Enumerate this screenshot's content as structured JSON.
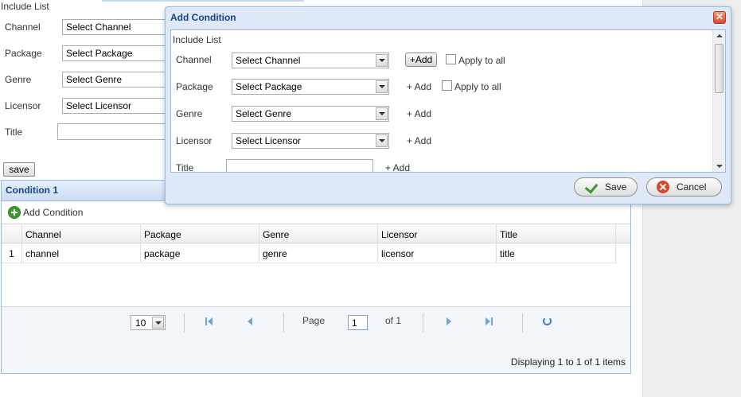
{
  "background_form": {
    "title": "Include List",
    "fields": [
      {
        "label": "Channel",
        "value": "Select Channel"
      },
      {
        "label": "Package",
        "value": "Select Package"
      },
      {
        "label": "Genre",
        "value": "Select Genre"
      },
      {
        "label": "Licensor",
        "value": "Select Licensor"
      }
    ],
    "title_label": "Title",
    "save_label": "save"
  },
  "condition_panel": {
    "header": "Condition 1",
    "add_condition_label": "Add Condition",
    "columns": [
      "Channel",
      "Package",
      "Genre",
      "Licensor",
      "Title"
    ],
    "rows": [
      {
        "num": "1",
        "cells": [
          "channel",
          "package",
          "genre",
          "licensor",
          "title"
        ]
      }
    ],
    "pager": {
      "page_size": "10",
      "page_label": "Page",
      "current_page": "1",
      "of_label": "of 1",
      "display_text": "Displaying 1 to 1 of 1 items"
    }
  },
  "modal": {
    "title": "Add Condition",
    "close_glyph": "✕",
    "include_list_label": "Include List",
    "rows": [
      {
        "label": "Channel",
        "value": "Select Channel"
      },
      {
        "label": "Package",
        "value": "Select Package"
      },
      {
        "label": "Genre",
        "value": "Select Genre"
      },
      {
        "label": "Licensor",
        "value": "Select Licensor"
      }
    ],
    "title_label": "Title",
    "add_button_label": "+Add",
    "add_link_label": "+ Add",
    "apply_to_all_label": "Apply to all",
    "save_label": "Save",
    "cancel_label": "Cancel"
  },
  "colors": {
    "panel_header_text": "#15428b",
    "panel_border": "#99bbe8",
    "accent_blue": "#6fa6d6",
    "green_icon": "#3a9a2c",
    "red_icon": "#d9472b"
  },
  "icons": [
    "add-condition-icon",
    "first-page-icon",
    "prev-page-icon",
    "next-page-icon",
    "last-page-icon",
    "refresh-icon",
    "close-icon",
    "check-icon",
    "cancel-icon"
  ]
}
